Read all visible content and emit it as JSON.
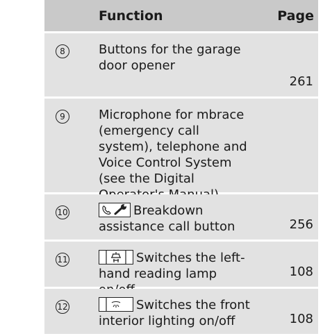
{
  "header": {
    "function": "Function",
    "page": "Page"
  },
  "rows": [
    {
      "num": "8",
      "text": "Buttons for the garage door opener",
      "page": "261"
    },
    {
      "num": "9",
      "text": "Microphone for mbrace (emergency call system), telephone and Voice Control System (see the Digital Operator's Manual)",
      "page": ""
    },
    {
      "num": "10",
      "text": "Breakdown assistance call button",
      "page": "256",
      "icon": "phone-wrench-icon"
    },
    {
      "num": "11",
      "text": "Switches the left-hand reading lamp on/off",
      "page": "108",
      "icon": "reading-lamp-icon"
    },
    {
      "num": "12",
      "text": "Switches the front interior lighting on/off",
      "page": "108",
      "icon": "interior-light-icon"
    }
  ]
}
